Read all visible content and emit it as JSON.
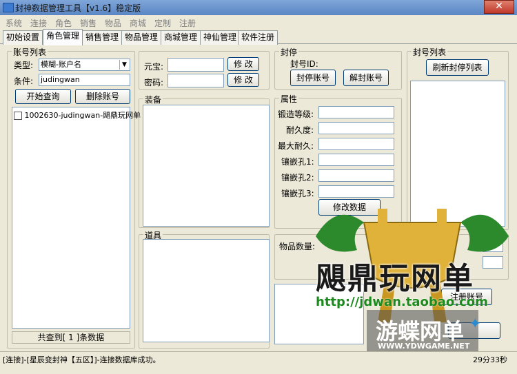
{
  "window": {
    "title": "封神数据管理工具【v1.6】稳定版",
    "close_glyph": "✕"
  },
  "menu": [
    "系统",
    "连接",
    "角色",
    "销售",
    "物品",
    "商城",
    "定制",
    "注册"
  ],
  "tabs": [
    "初始设置",
    "角色管理",
    "销售管理",
    "物品管理",
    "商城管理",
    "神仙管理",
    "软件注册"
  ],
  "account_list": {
    "title": "账号列表",
    "type_label": "类型:",
    "type_value": "模糊-账户名",
    "condition_label": "条件:",
    "condition_value": "judingwan",
    "query_button": "开始查询",
    "delete_button": "删除账号",
    "items": [
      "1002630-judingwan-飓鼎玩网单"
    ],
    "footer": "共查到[ 1 ]条数据"
  },
  "currency": {
    "yuanbao_label": "元宝:",
    "password_label": "密码:",
    "modify_label": "修 改"
  },
  "equipment": {
    "title": "装备"
  },
  "props": {
    "title": "道具"
  },
  "ban": {
    "title": "封停",
    "id_label": "封号ID:",
    "ban_button": "封停账号",
    "unban_button": "解封账号"
  },
  "attributes": {
    "title": "属性",
    "labels": [
      "锻造等级:",
      "耐久度:",
      "最大耐久:",
      "镶嵌孔1:",
      "镶嵌孔2:",
      "镶嵌孔3:"
    ],
    "modify_button": "修改数据"
  },
  "item_count": {
    "label": "物品数量:"
  },
  "register_button": "注册账号",
  "ban_list": {
    "title": "封号列表",
    "refresh_button": "刷新封停列表"
  },
  "statusbar": {
    "message": "[连接]-[星辰变封神【五区】]-连接数据库成功。",
    "time": "29分33秒"
  },
  "watermarks": {
    "logo": "飓鼎玩网单",
    "url": "http://jdwan.taobao.com",
    "logo2": "游蝶网单",
    "url2": "WWW.YDWGAME.NET"
  },
  "colors": {
    "titlebar": "#5a86c4",
    "close": "#c0392b",
    "logo_gold": "#e0b23a",
    "logo_green": "#2c8a2c"
  }
}
